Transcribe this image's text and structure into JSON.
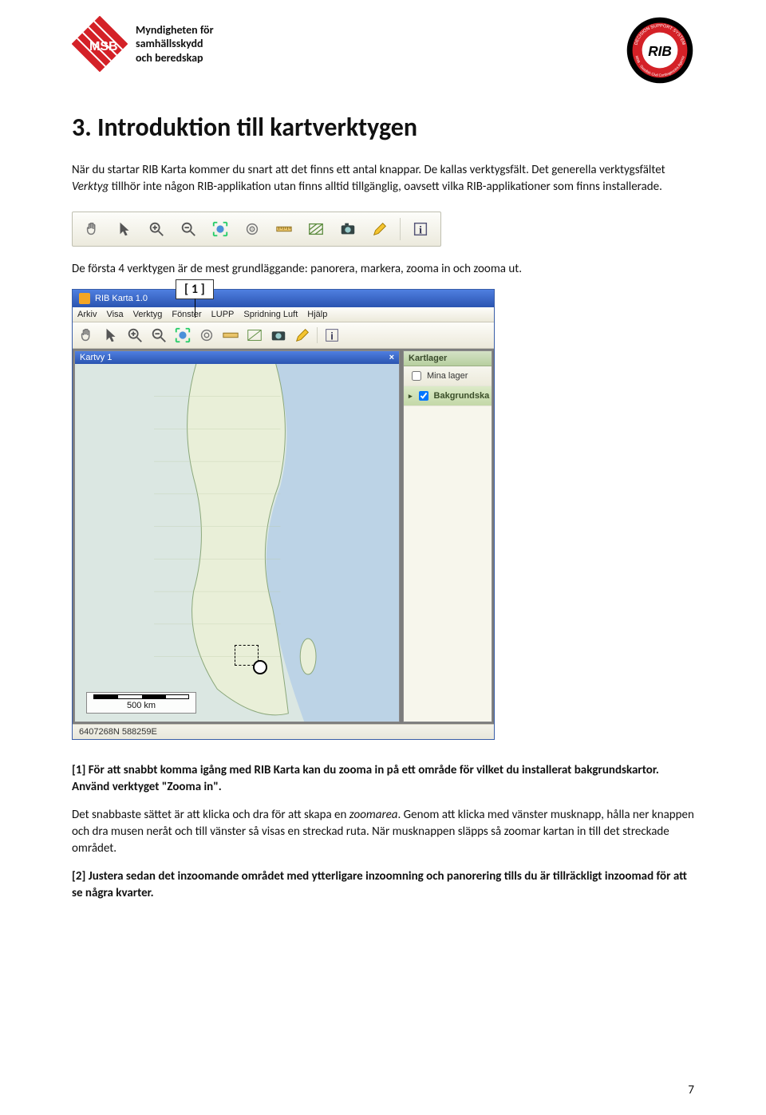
{
  "header": {
    "msb_line1": "Myndigheten för",
    "msb_line2": "samhällsskydd",
    "msb_line3": "och beredskap",
    "msb_label": "MSB",
    "rib_top": "DECISION SUPPORT SYSTEM",
    "rib_center": "RIB",
    "rib_bottom": "MSB · Swedish Civil Contingencies Agency"
  },
  "title": "3. Introduktion till kartverktygen",
  "p1a": "När du startar RIB Karta kommer du snart att det finns ett antal knappar. De kallas verktygsfält. Det generella verktygsfältet ",
  "p1b_italic": "Verktyg",
  "p1c": " tillhör inte någon RIB-applikation utan finns alltid tillgänglig, oavsett vilka RIB-applikationer som finns installerade.",
  "toolbar_icons": [
    {
      "name": "pan-icon"
    },
    {
      "name": "pointer-icon"
    },
    {
      "name": "zoom-in-icon"
    },
    {
      "name": "zoom-out-icon"
    },
    {
      "name": "zoom-extent-icon"
    },
    {
      "name": "target-icon"
    },
    {
      "name": "measure-icon"
    },
    {
      "name": "hatch-icon"
    },
    {
      "name": "camera-icon"
    },
    {
      "name": "pencil-icon"
    },
    {
      "name": "info-icon"
    }
  ],
  "p2": "De första 4 verktygen är de mest grundläggande: panorera, markera, zooma in och zooma ut.",
  "callout": "[ 1 ]",
  "app": {
    "title": "RIB Karta 1.0",
    "menu": [
      "Arkiv",
      "Visa",
      "Verktyg",
      "Fönster",
      "LUPP",
      "Spridning Luft",
      "Hjälp"
    ],
    "map_tab": "Kartvy 1",
    "layers_header": "Kartlager",
    "layer1": "Mina lager",
    "layer2": "Bakgrundska",
    "scale_label": "500 km",
    "status": "6407268N  588259E"
  },
  "p3a": "[1] För att snabbt komma igång med RIB Karta kan du zooma in på ett område för vilket du installerat bakgrundskartor. Använd verktyget \"Zooma in\".",
  "p4a": "Det snabbaste sättet är att klicka och dra för att skapa en ",
  "p4b_italic": "zoomarea",
  "p4c": ". Genom att klicka med vänster musknapp, hålla ner knappen och dra musen neråt och till vänster så visas en streckad ruta. När musknappen släpps så zoomar kartan in till det streckade området.",
  "p5": "[2] Justera sedan det inzoomande området med ytterligare inzoomning och panorering tills du är tillräckligt inzoomad för att se några kvarter.",
  "page_number": "7"
}
